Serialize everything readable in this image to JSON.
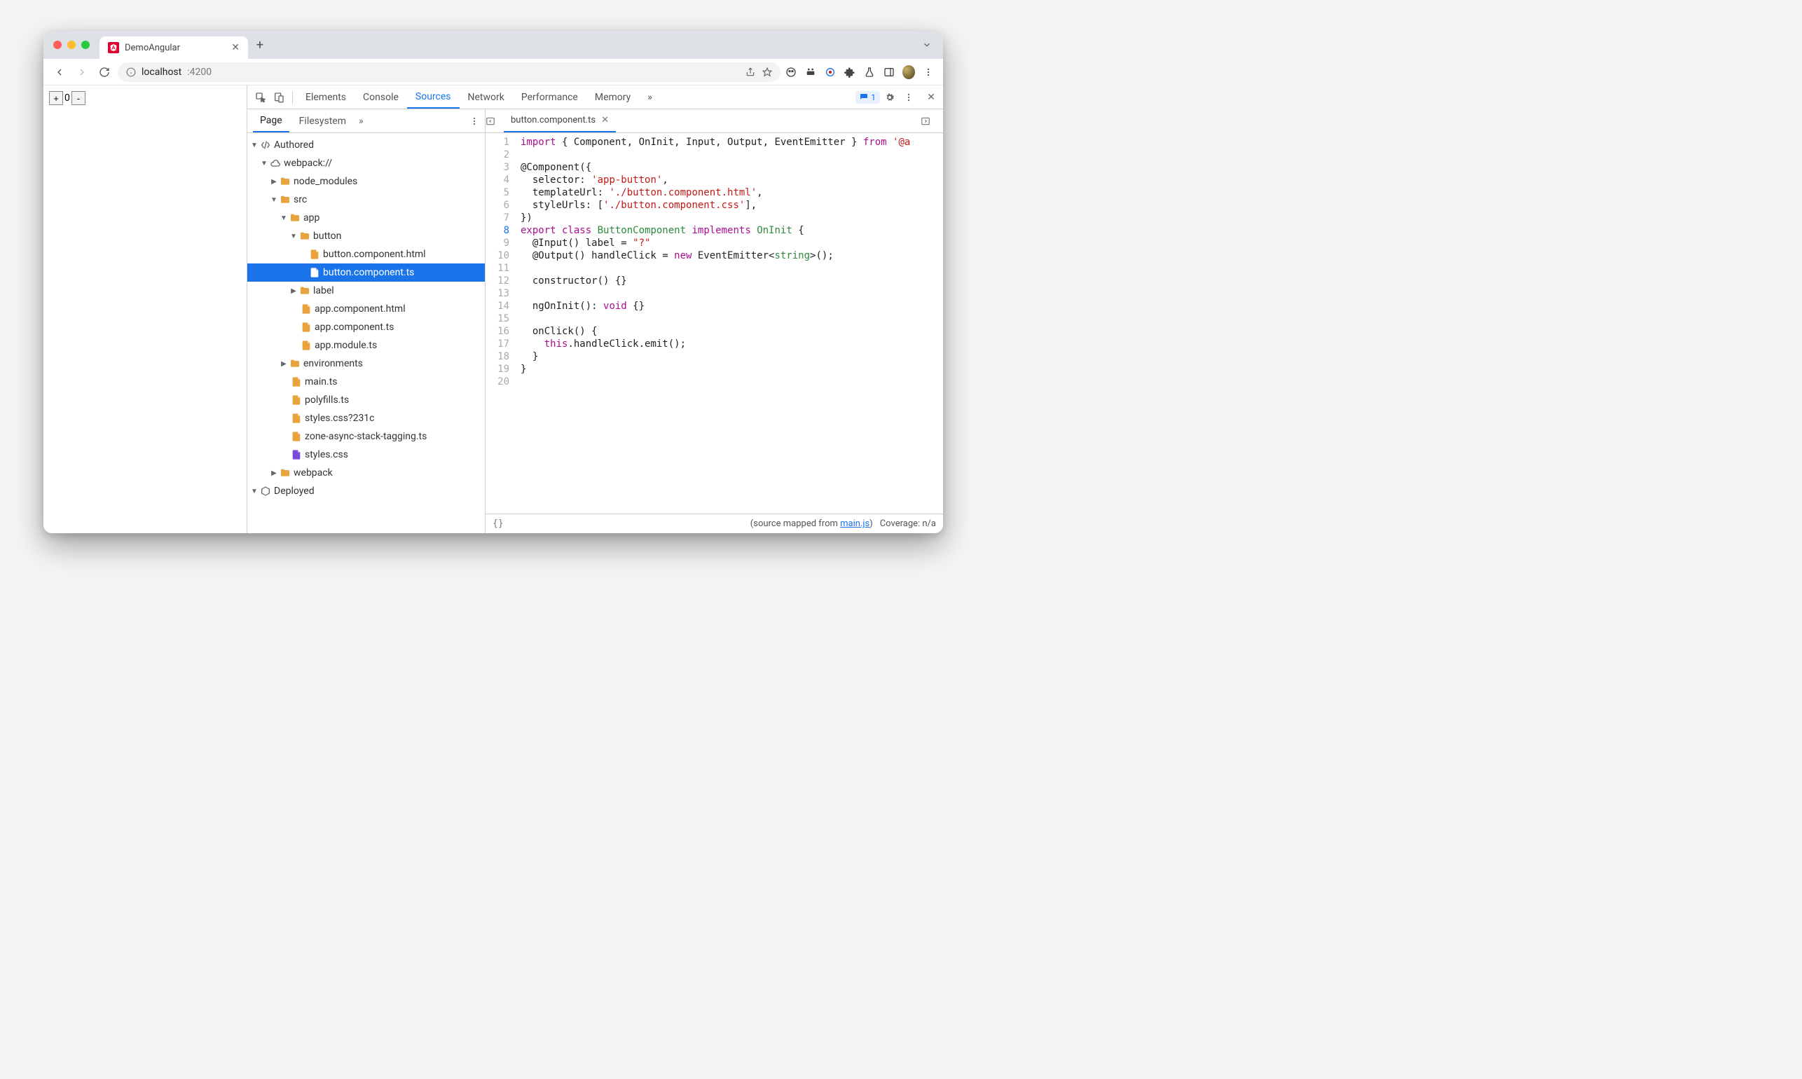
{
  "browser": {
    "tab_title": "DemoAngular",
    "url_host": "localhost",
    "url_port": ":4200"
  },
  "page": {
    "counter_value": "0",
    "plus": "+",
    "minus": "-"
  },
  "devtools": {
    "tabs": [
      "Elements",
      "Console",
      "Sources",
      "Network",
      "Performance",
      "Memory"
    ],
    "active_tab": "Sources",
    "issues_count": "1"
  },
  "sources": {
    "subtabs": [
      "Page",
      "Filesystem"
    ],
    "active_subtab": "Page",
    "tree": {
      "authored": "Authored",
      "webpack": "webpack://",
      "node_modules": "node_modules",
      "src": "src",
      "app": "app",
      "button": "button",
      "button_html": "button.component.html",
      "button_ts": "button.component.ts",
      "label": "label",
      "app_html": "app.component.html",
      "app_ts": "app.component.ts",
      "app_module": "app.module.ts",
      "environments": "environments",
      "main_ts": "main.ts",
      "polyfills": "polyfills.ts",
      "styles_hash": "styles.css?231c",
      "zone_tag": "zone-async-stack-tagging.ts",
      "styles": "styles.css",
      "webpack_folder": "webpack",
      "deployed": "Deployed"
    }
  },
  "editor": {
    "filename": "button.component.ts",
    "lines_total": 20,
    "code": {
      "l1_a": "import",
      "l1_b": " { Component, OnInit, Input, Output, EventEmitter } ",
      "l1_c": "from",
      "l1_d": " '@a",
      "l3": "@Component({",
      "l4_a": "  selector: ",
      "l4_b": "'app-button'",
      "l4_c": ",",
      "l5_a": "  templateUrl: ",
      "l5_b": "'./button.component.html'",
      "l5_c": ",",
      "l6_a": "  styleUrls: [",
      "l6_b": "'./button.component.css'",
      "l6_c": "],",
      "l7": "})",
      "l8_a": "export",
      "l8_b": " class ",
      "l8_c": "ButtonComponent",
      "l8_d": " implements ",
      "l8_e": "OnInit",
      "l8_f": " {",
      "l9_a": "  @Input() label = ",
      "l9_b": "\"?\"",
      "l10_a": "  @Output() handleClick = ",
      "l10_b": "new",
      "l10_c": " EventEmitter<",
      "l10_d": "string",
      "l10_e": ">();",
      "l12": "  constructor() {}",
      "l14_a": "  ngOnInit(): ",
      "l14_b": "void",
      "l14_c": " {}",
      "l16": "  onClick() {",
      "l17_a": "    ",
      "l17_b": "this",
      "l17_c": ".handleClick.emit();",
      "l18": "  }",
      "l19": "}"
    },
    "status_mapped_prefix": "(source mapped from ",
    "status_mapped_link": "main.js",
    "status_mapped_suffix": ")",
    "coverage": "Coverage: n/a"
  }
}
